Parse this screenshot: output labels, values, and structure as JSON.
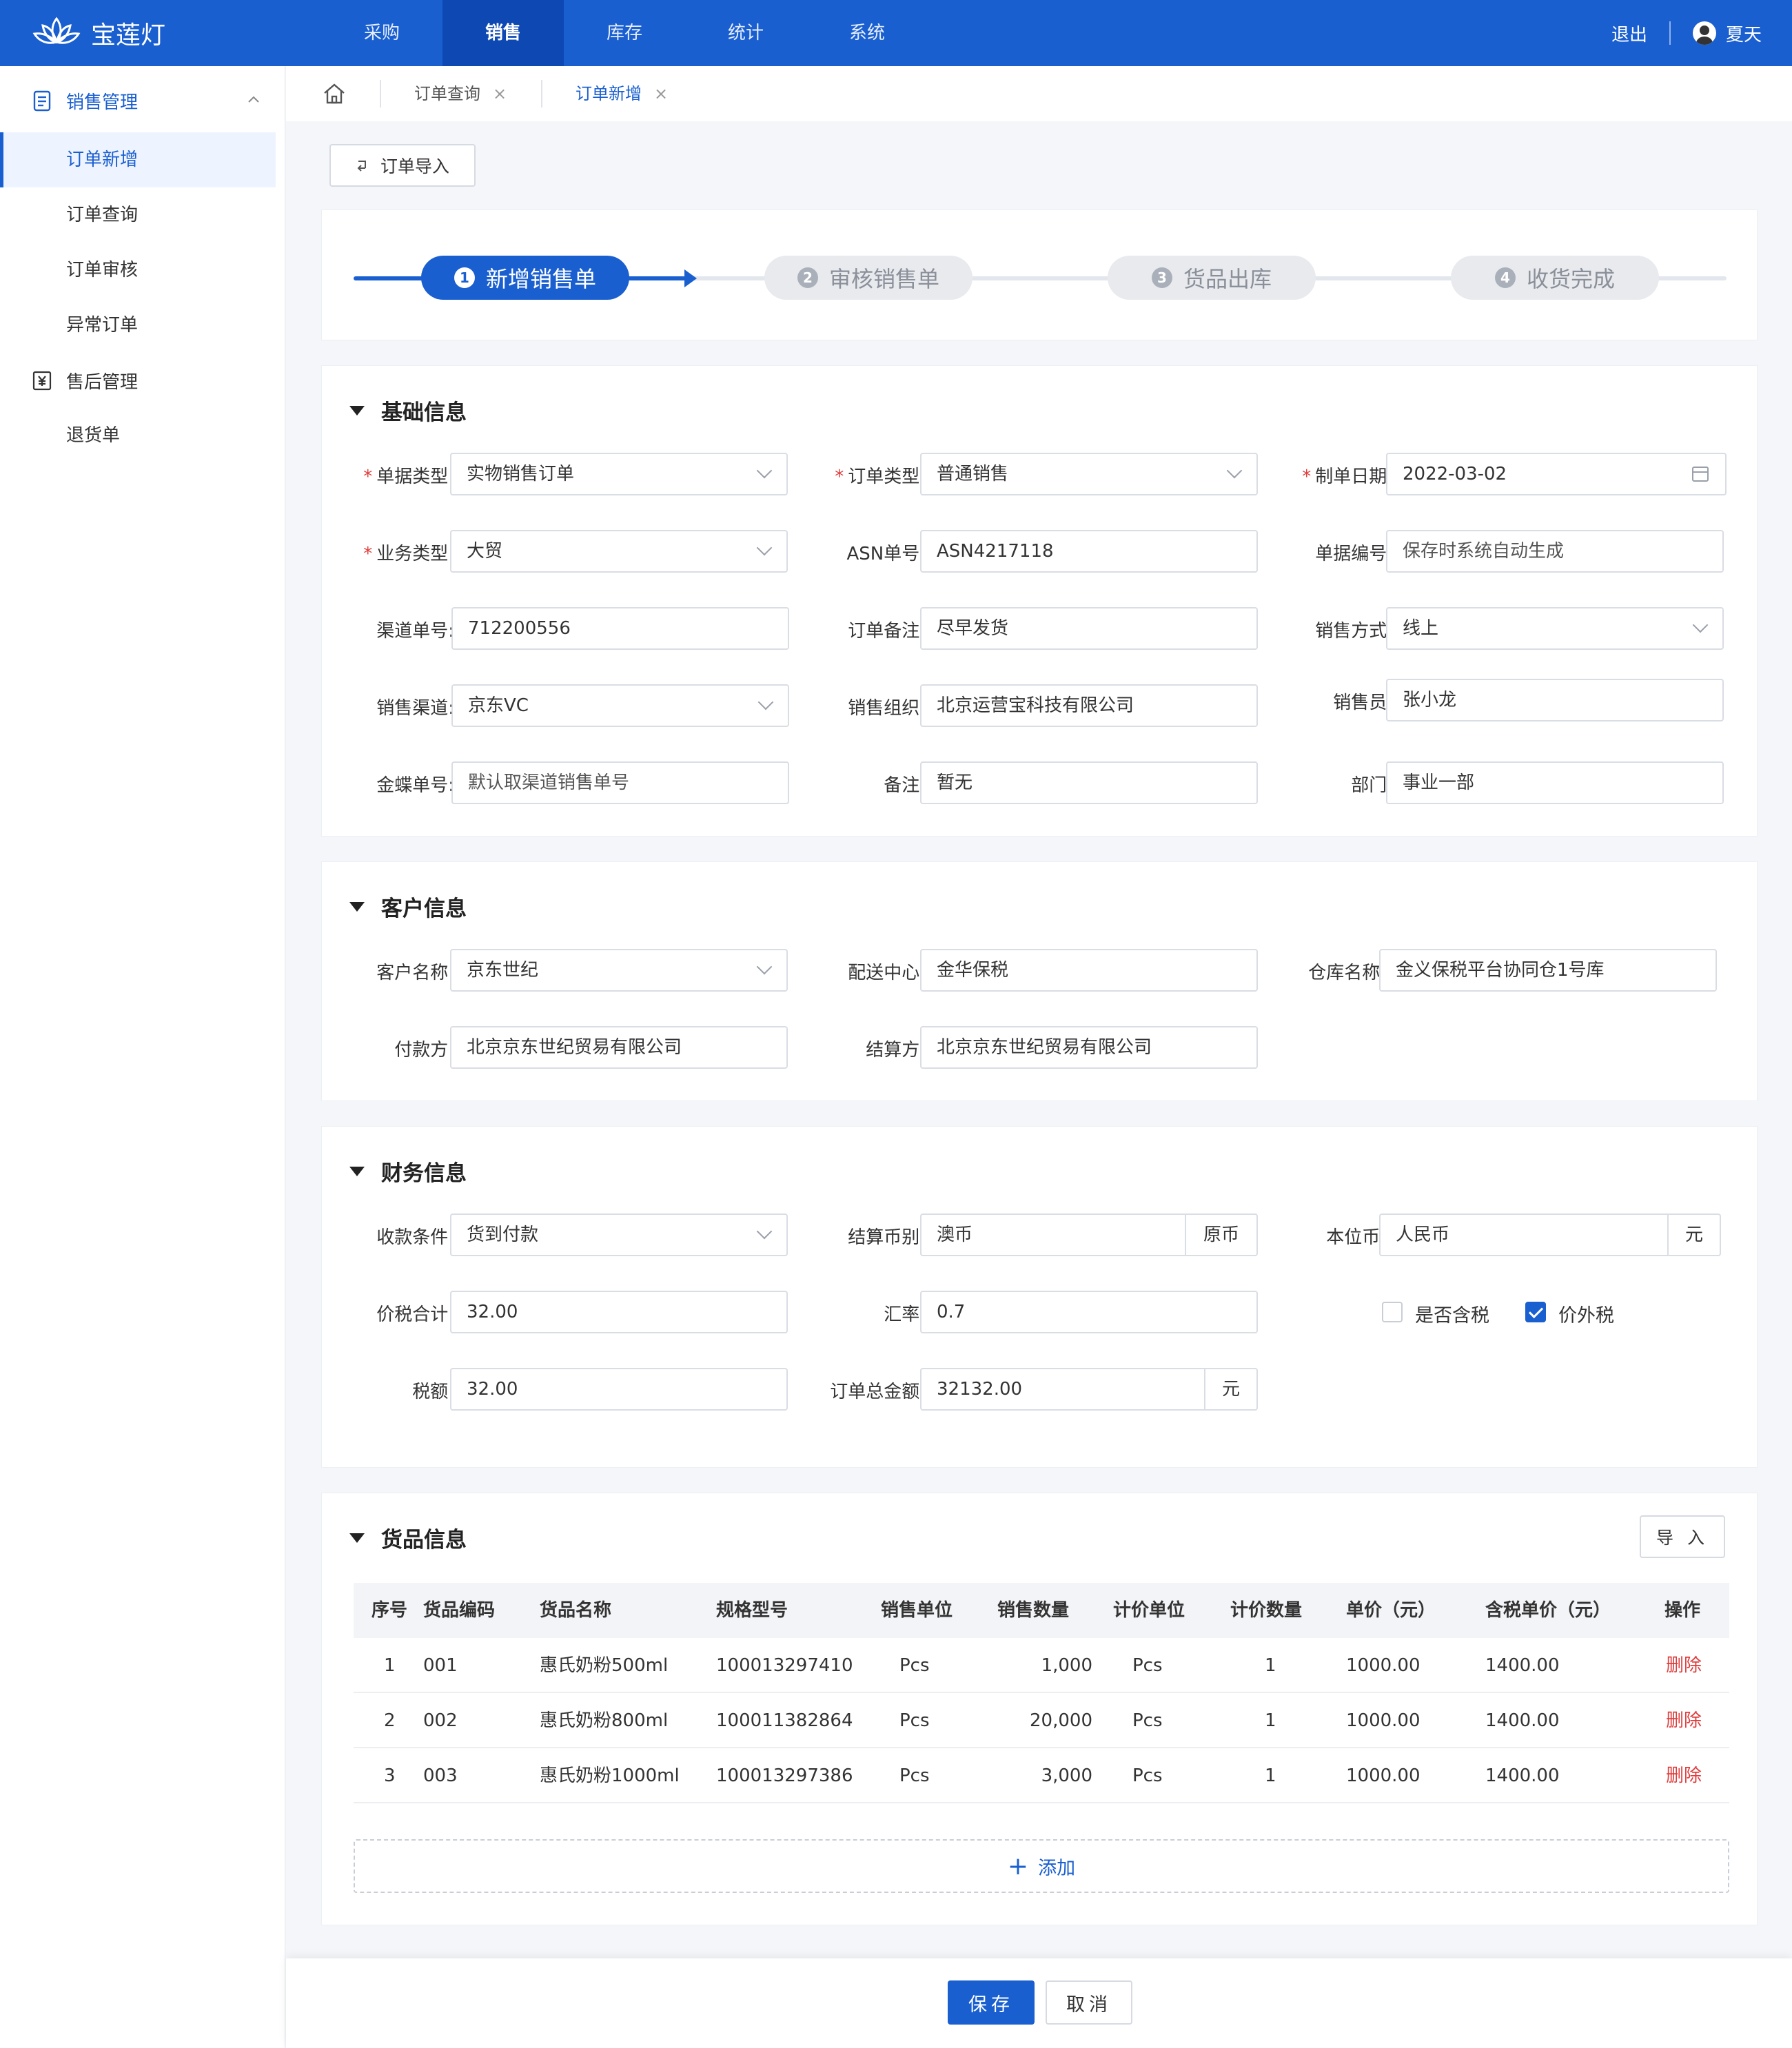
{
  "app": {
    "name": "宝莲灯"
  },
  "topnav": {
    "items": [
      "采购",
      "销售",
      "库存",
      "统计",
      "系统"
    ],
    "active_index": 1,
    "logout": "退出",
    "user": "夏天"
  },
  "sidebar": {
    "groups": [
      {
        "label": "销售管理",
        "items": [
          "订单新增",
          "订单查询",
          "订单审核",
          "异常订单"
        ]
      },
      {
        "label": "售后管理",
        "items": [
          "退货单"
        ]
      }
    ],
    "active_item": "订单新增"
  },
  "tabs": [
    {
      "label": "订单查询",
      "close": "×"
    },
    {
      "label": "订单新增",
      "close": "×"
    }
  ],
  "import_order_button": "订单导入",
  "steps": [
    {
      "num": "1",
      "label": "新增销售单",
      "active": true
    },
    {
      "num": "2",
      "label": "审核销售单",
      "active": false
    },
    {
      "num": "3",
      "label": "货品出库",
      "active": false
    },
    {
      "num": "4",
      "label": "收货完成",
      "active": false
    }
  ],
  "basic": {
    "title": "基础信息",
    "fields": {
      "doc_type": {
        "label": "单据类型:",
        "value": "实物销售订单",
        "required": true
      },
      "order_type": {
        "label": "订单类型:",
        "value": "普通销售",
        "required": true
      },
      "date": {
        "label": "制单日期:",
        "value": "2022-03-02",
        "required": true
      },
      "biz_type": {
        "label": "业务类型:",
        "value": "大贸",
        "required": true
      },
      "asn": {
        "label": "ASN单号:",
        "value": "ASN4217118"
      },
      "doc_no": {
        "label": "单据编号:",
        "value": "保存时系统自动生成"
      },
      "channel_no": {
        "label": "渠道单号:",
        "value": "712200556"
      },
      "order_note": {
        "label": "订单备注:",
        "value": "尽早发货"
      },
      "sale_mode": {
        "label": "销售方式:",
        "value": "线上"
      },
      "channel": {
        "label": "销售渠道:",
        "value": "京东VC"
      },
      "org": {
        "label": "销售组织:",
        "value": "北京运营宝科技有限公司"
      },
      "salesman": {
        "label": "销售员:",
        "value": "张小龙"
      },
      "kingdee": {
        "label": "金蝶单号:",
        "value": "默认取渠道销售单号"
      },
      "remark": {
        "label": "备注:",
        "value": "暂无"
      },
      "dept": {
        "label": "部门:",
        "value": "事业一部"
      }
    }
  },
  "customer": {
    "title": "客户信息",
    "fields": {
      "name": {
        "label": "客户名称:",
        "value": "京东世纪"
      },
      "dc": {
        "label": "配送中心:",
        "value": "金华保税"
      },
      "warehouse": {
        "label": "仓库名称:",
        "value": "金义保税平台协同仓1号库"
      },
      "payer": {
        "label": "付款方:",
        "value": "北京京东世纪贸易有限公司"
      },
      "settler": {
        "label": "结算方:",
        "value": "北京京东世纪贸易有限公司"
      }
    }
  },
  "finance": {
    "title": "财务信息",
    "fields": {
      "terms": {
        "label": "收款条件:",
        "value": "货到付款"
      },
      "currency": {
        "label": "结算币别:",
        "value": "澳币",
        "addon": "原币"
      },
      "base_currency": {
        "label": "本位币:",
        "value": "人民币",
        "addon": "元"
      },
      "total_tax": {
        "label": "价税合计:",
        "value": "32.00"
      },
      "rate": {
        "label": "汇率:",
        "value": "0.7"
      },
      "tax": {
        "label": "税额:",
        "value": "32.00"
      },
      "order_total": {
        "label": "订单总金额:",
        "value": "32132.00",
        "addon": "元"
      }
    },
    "checkboxes": [
      {
        "label": "是否含税",
        "checked": false
      },
      {
        "label": "价外税",
        "checked": true
      }
    ]
  },
  "goods": {
    "title": "货品信息",
    "import_button": "导 入",
    "columns": [
      "序号",
      "货品编码",
      "货品名称",
      "规格型号",
      "销售单位",
      "销售数量",
      "计价单位",
      "计价数量",
      "单价（元）",
      "含税单价（元）",
      "操作"
    ],
    "rows": [
      [
        "1",
        "001",
        "惠氏奶粉500ml",
        "100013297410",
        "Pcs",
        "1,000",
        "Pcs",
        "1",
        "1000.00",
        "1400.00",
        "删除"
      ],
      [
        "2",
        "002",
        "惠氏奶粉800ml",
        "100011382864",
        "Pcs",
        "20,000",
        "Pcs",
        "1",
        "1000.00",
        "1400.00",
        "删除"
      ],
      [
        "3",
        "003",
        "惠氏奶粉1000ml",
        "100013297386",
        "Pcs",
        "3,000",
        "Pcs",
        "1",
        "1000.00",
        "1400.00",
        "删除"
      ]
    ],
    "add_label": "添加",
    "add_symbol": "+"
  },
  "footer": {
    "save": "保存",
    "cancel": "取消"
  },
  "colors": {
    "primary": "#1a5fd0",
    "danger": "#e03c3c"
  }
}
